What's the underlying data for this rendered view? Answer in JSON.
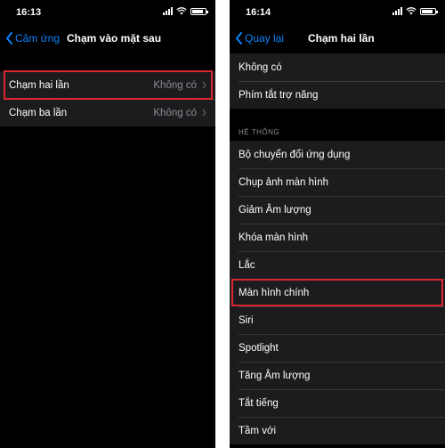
{
  "left": {
    "time": "16:13",
    "back_label": "Cảm ứng",
    "title": "Chạm vào mặt sau",
    "rows": [
      {
        "label": "Chạm hai lần",
        "value": "Không có"
      },
      {
        "label": "Chạm ba lần",
        "value": "Không có"
      }
    ]
  },
  "right": {
    "time": "16:14",
    "back_label": "Quay lại",
    "title": "Chạm hai lần",
    "top_rows": [
      {
        "label": "Không có"
      },
      {
        "label": "Phím tắt trợ năng"
      }
    ],
    "section_header": "HỆ THỐNG",
    "system_rows": [
      {
        "label": "Bộ chuyển đổi ứng dụng"
      },
      {
        "label": "Chụp ảnh màn hình"
      },
      {
        "label": "Giảm Âm lượng"
      },
      {
        "label": "Khóa màn hình"
      },
      {
        "label": "Lắc"
      },
      {
        "label": "Màn hình chính"
      },
      {
        "label": "Siri"
      },
      {
        "label": "Spotlight"
      },
      {
        "label": "Tăng Âm lượng"
      },
      {
        "label": "Tắt tiếng"
      },
      {
        "label": "Tầm với"
      }
    ]
  },
  "colors": {
    "accent": "#0a84ff",
    "highlight": "#d9282f",
    "background": "#000000",
    "cell": "#1c1c1e"
  }
}
